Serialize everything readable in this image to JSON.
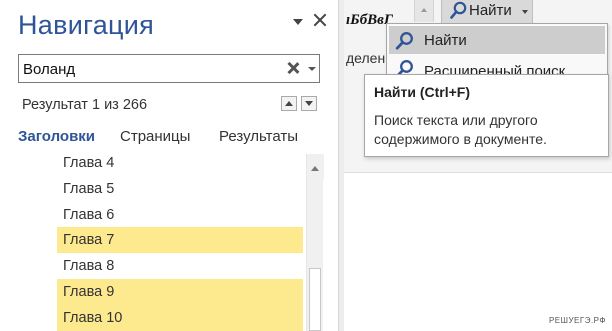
{
  "nav_pane": {
    "title": "Навигация",
    "search": {
      "value": "Воланд",
      "placeholder": ""
    },
    "result_count": "Результат 1 из 266",
    "tabs": [
      {
        "label": "Заголовки",
        "active": true
      },
      {
        "label": "Страницы",
        "active": false
      },
      {
        "label": "Результаты",
        "active": false
      }
    ],
    "headings": [
      {
        "label": "Глава 4",
        "highlighted": false
      },
      {
        "label": "Глава 5",
        "highlighted": false
      },
      {
        "label": "Глава 6",
        "highlighted": false
      },
      {
        "label": "Глава 7",
        "highlighted": true
      },
      {
        "label": "Глава 8",
        "highlighted": false
      },
      {
        "label": "Глава 9",
        "highlighted": true
      },
      {
        "label": "Глава 10",
        "highlighted": true
      }
    ]
  },
  "ribbon": {
    "style_sample": "ıБбВвГ",
    "section_text": "делен",
    "find_button": {
      "label": "Найти"
    },
    "find_menu": {
      "items": [
        {
          "label": "Найти",
          "selected": true
        },
        {
          "label": "Расширенный поиск",
          "selected": false
        }
      ]
    }
  },
  "tooltip": {
    "title": "Найти (Ctrl+F)",
    "body": "Поиск текста или другого содержимого в документе."
  },
  "watermark": "РЕШУЕГЭ.РФ",
  "colors": {
    "nav_title": "#2f5597",
    "active_tab": "#2f5597",
    "highlight": "#fdea8f",
    "menu_selected": "#cdcdcd",
    "ribbon_bg": "#f4f4f4"
  }
}
